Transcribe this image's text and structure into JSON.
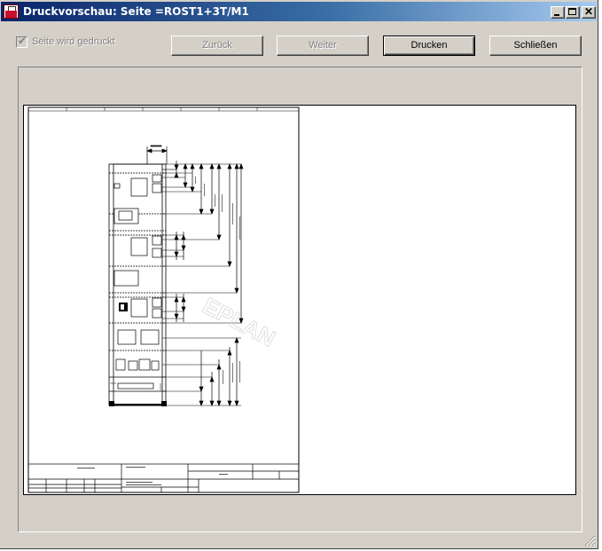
{
  "window": {
    "title": "Druckvorschau: Seite =ROST1+3T/M1",
    "icon": "eplan-app-icon",
    "caption_buttons": {
      "minimize": "minimize-icon",
      "maximize": "maximize-icon",
      "close": "close-icon",
      "close_glyph": "✕"
    }
  },
  "toolbar": {
    "checkbox_label": "Seite wird gedruckt",
    "checkbox_checked": true,
    "back_label": "Zurück",
    "next_label": "Weiter",
    "print_label": "Drucken",
    "close_label": "Schließen"
  },
  "preview": {
    "description_icon": "schematic-drawing",
    "watermark": "EPLAN",
    "pages_shown": 1
  },
  "colors": {
    "title_start": "#0a246a",
    "title_end": "#a6caf0",
    "face": "#d4d0c8"
  }
}
